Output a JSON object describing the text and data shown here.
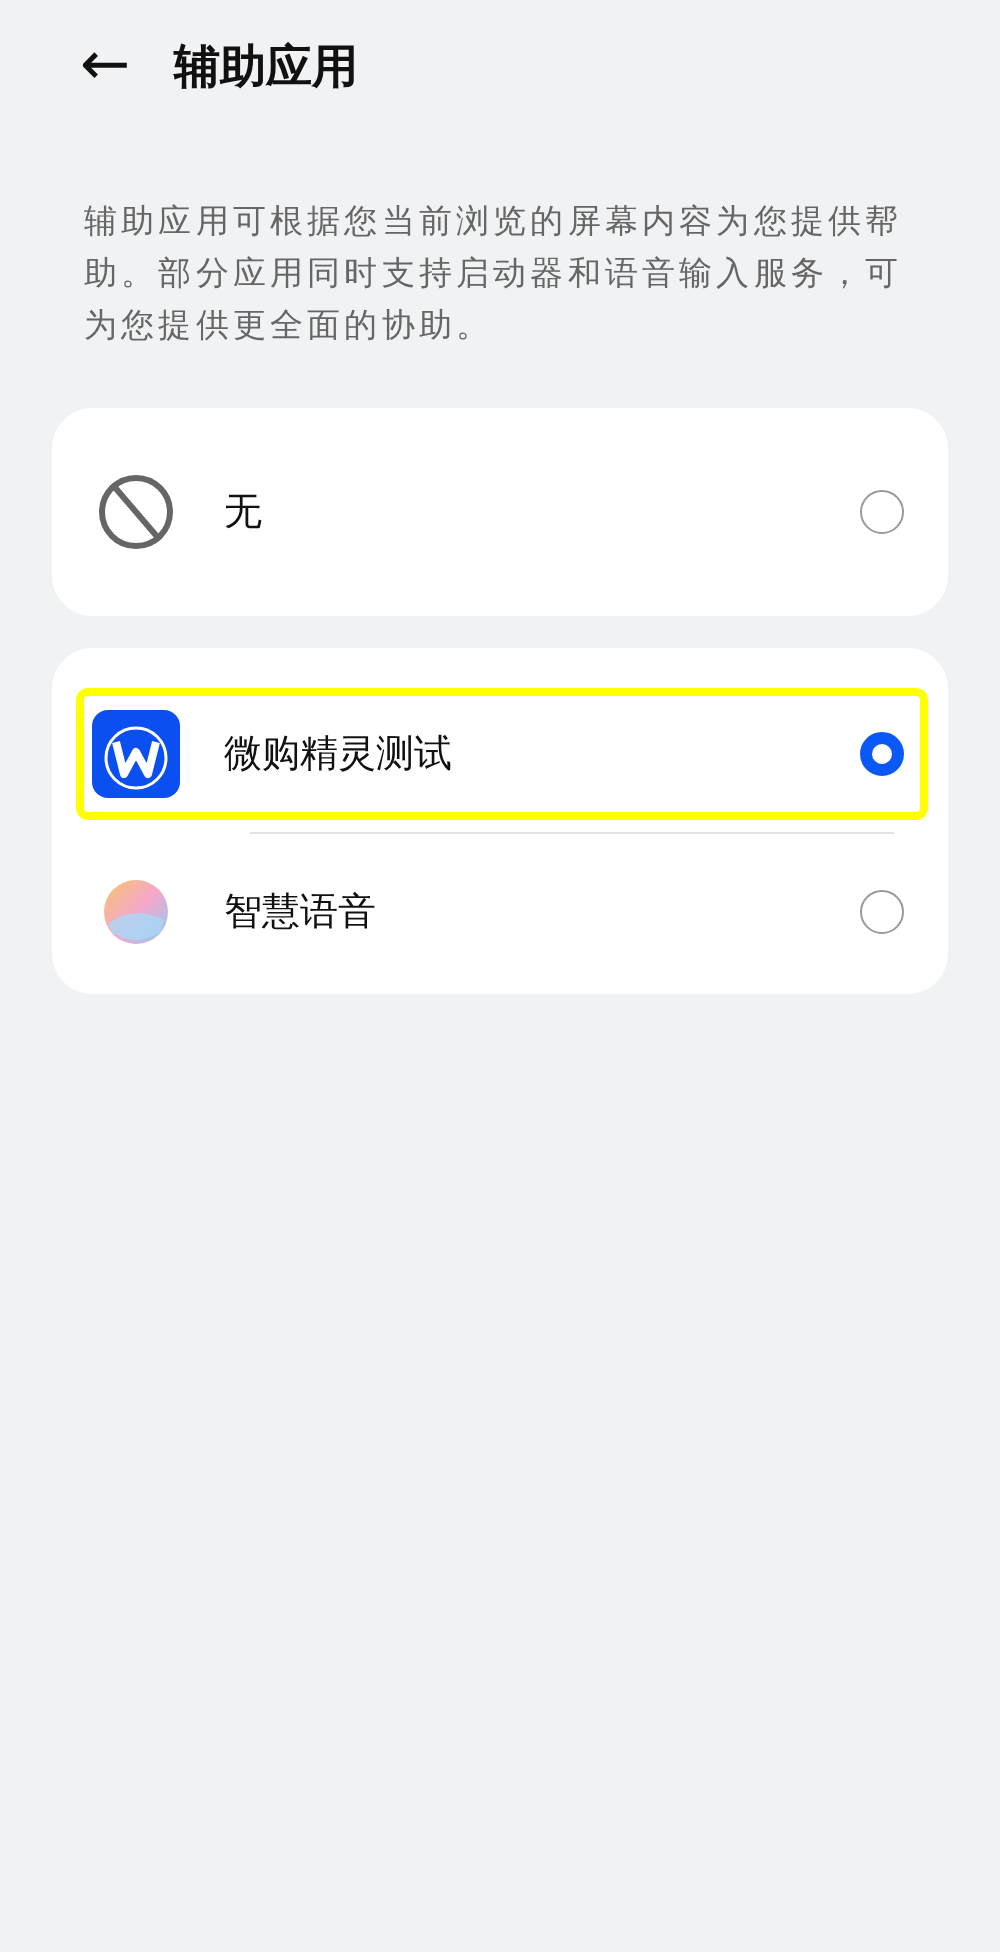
{
  "header": {
    "back": "←",
    "title": "辅助应用"
  },
  "description": "辅助应用可根据您当前浏览的屏幕内容为您提供帮助。部分应用同时支持启动器和语音输入服务，可为您提供更全面的协助。",
  "groups": [
    {
      "items": [
        {
          "label": "无",
          "kind": "none",
          "selected": false,
          "highlighted": false
        }
      ]
    },
    {
      "items": [
        {
          "label": "微购精灵测试",
          "kind": "app",
          "selected": true,
          "highlighted": true
        },
        {
          "label": "智慧语音",
          "kind": "voice",
          "selected": false,
          "highlighted": false
        }
      ]
    }
  ]
}
